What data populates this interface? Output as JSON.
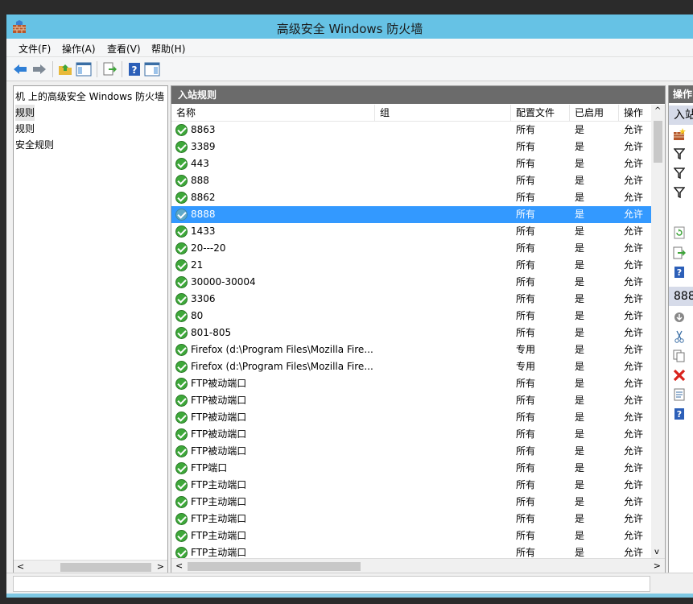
{
  "window": {
    "title": "高级安全 Windows 防火墙"
  },
  "menu": [
    "文件(F)",
    "操作(A)",
    "查看(V)",
    "帮助(H)"
  ],
  "tree": {
    "items": [
      "机 上的高级安全 Windows 防火墙",
      "规则",
      "规则",
      "安全规则"
    ]
  },
  "center": {
    "title": "入站规则",
    "columns": [
      "名称",
      "组",
      "配置文件",
      "已启用",
      "操作"
    ],
    "rows": [
      {
        "name": "8863",
        "profile": "所有",
        "enabled": "是",
        "action": "允许"
      },
      {
        "name": "3389",
        "profile": "所有",
        "enabled": "是",
        "action": "允许"
      },
      {
        "name": "443",
        "profile": "所有",
        "enabled": "是",
        "action": "允许"
      },
      {
        "name": "888",
        "profile": "所有",
        "enabled": "是",
        "action": "允许"
      },
      {
        "name": "8862",
        "profile": "所有",
        "enabled": "是",
        "action": "允许"
      },
      {
        "name": "8888",
        "profile": "所有",
        "enabled": "是",
        "action": "允许"
      },
      {
        "name": "1433",
        "profile": "所有",
        "enabled": "是",
        "action": "允许"
      },
      {
        "name": "20---20",
        "profile": "所有",
        "enabled": "是",
        "action": "允许"
      },
      {
        "name": "21",
        "profile": "所有",
        "enabled": "是",
        "action": "允许"
      },
      {
        "name": "30000-30004",
        "profile": "所有",
        "enabled": "是",
        "action": "允许"
      },
      {
        "name": "3306",
        "profile": "所有",
        "enabled": "是",
        "action": "允许"
      },
      {
        "name": "80",
        "profile": "所有",
        "enabled": "是",
        "action": "允许"
      },
      {
        "name": "801-805",
        "profile": "所有",
        "enabled": "是",
        "action": "允许"
      },
      {
        "name": "Firefox (d:\\Program Files\\Mozilla Fire...",
        "profile": "专用",
        "enabled": "是",
        "action": "允许"
      },
      {
        "name": "Firefox (d:\\Program Files\\Mozilla Fire...",
        "profile": "专用",
        "enabled": "是",
        "action": "允许"
      },
      {
        "name": "FTP被动端口",
        "profile": "所有",
        "enabled": "是",
        "action": "允许"
      },
      {
        "name": "FTP被动端口",
        "profile": "所有",
        "enabled": "是",
        "action": "允许"
      },
      {
        "name": "FTP被动端口",
        "profile": "所有",
        "enabled": "是",
        "action": "允许"
      },
      {
        "name": "FTP被动端口",
        "profile": "所有",
        "enabled": "是",
        "action": "允许"
      },
      {
        "name": "FTP被动端口",
        "profile": "所有",
        "enabled": "是",
        "action": "允许"
      },
      {
        "name": "FTP端口",
        "profile": "所有",
        "enabled": "是",
        "action": "允许"
      },
      {
        "name": "FTP主动端口",
        "profile": "所有",
        "enabled": "是",
        "action": "允许"
      },
      {
        "name": "FTP主动端口",
        "profile": "所有",
        "enabled": "是",
        "action": "允许"
      },
      {
        "name": "FTP主动端口",
        "profile": "所有",
        "enabled": "是",
        "action": "允许"
      },
      {
        "name": "FTP主动端口",
        "profile": "所有",
        "enabled": "是",
        "action": "允许"
      },
      {
        "name": "FTP主动端口",
        "profile": "所有",
        "enabled": "是",
        "action": "允许"
      }
    ],
    "selected_index": 5
  },
  "actions": {
    "title": "操作",
    "section1": "入站",
    "section2": "888"
  },
  "colors": {
    "selection": "#3399ff",
    "title_bar": "#66c2e5",
    "pane_header": "#6b6b6b"
  }
}
